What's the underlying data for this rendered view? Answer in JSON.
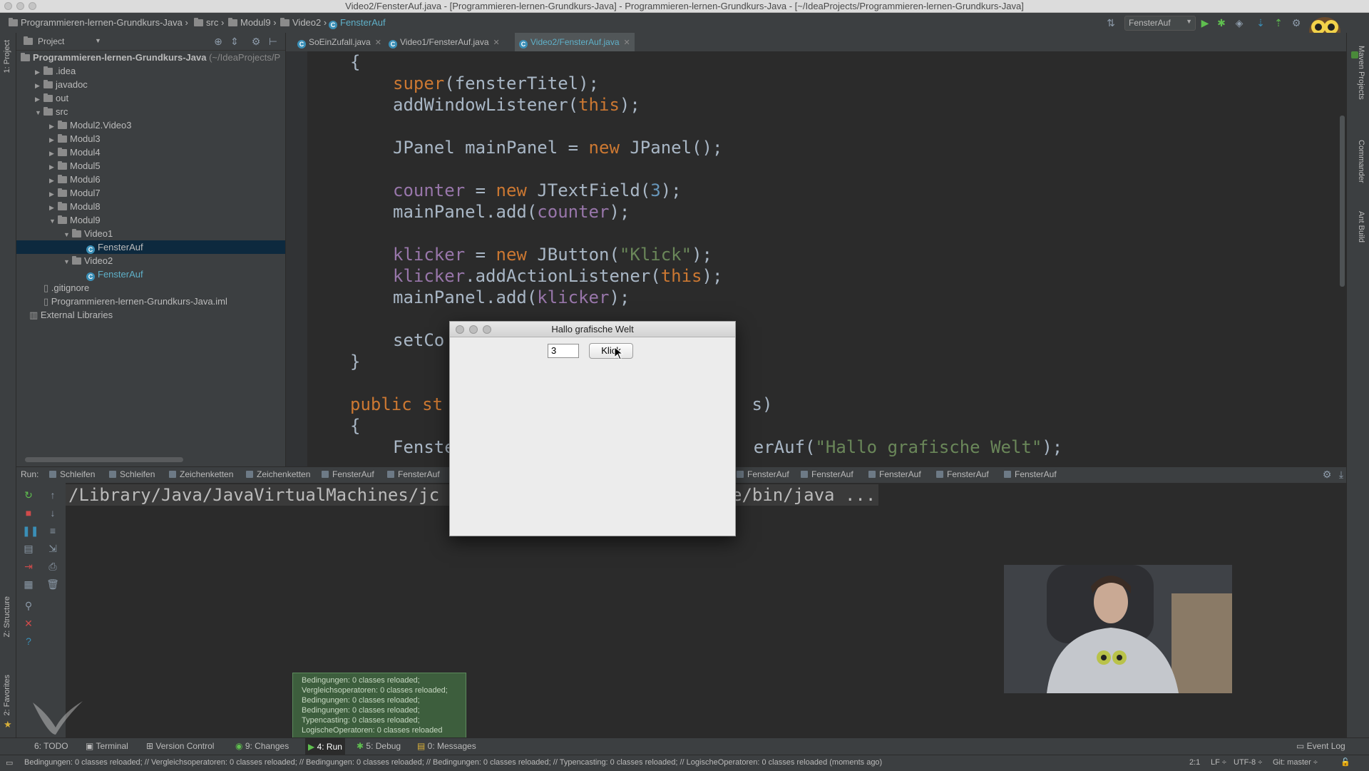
{
  "window": {
    "title": "Video2/FensterAuf.java - [Programmieren-lernen-Grundkurs-Java] - Programmieren-lernen-Grundkurs-Java - [~/IdeaProjects/Programmieren-lernen-Grundkurs-Java]"
  },
  "breadcrumb": [
    "Programmieren-lernen-Grundkurs-Java",
    "src",
    "Modul9",
    "Video2",
    "FensterAuf"
  ],
  "run_config": "FensterAuf",
  "project_panel": {
    "header": "Project",
    "root_name": "Programmieren-lernen-Grundkurs-Java",
    "root_path": "(~/IdeaProjects/P",
    "items": [
      {
        "label": ".idea",
        "indent": 1,
        "arrow": "▶"
      },
      {
        "label": "javadoc",
        "indent": 1,
        "arrow": "▶"
      },
      {
        "label": "out",
        "indent": 1,
        "arrow": "▶"
      },
      {
        "label": "src",
        "indent": 1,
        "arrow": "▼"
      },
      {
        "label": "Modul2.Video3",
        "indent": 2,
        "arrow": "▶"
      },
      {
        "label": "Modul3",
        "indent": 2,
        "arrow": "▶"
      },
      {
        "label": "Modul4",
        "indent": 2,
        "arrow": "▶"
      },
      {
        "label": "Modul5",
        "indent": 2,
        "arrow": "▶"
      },
      {
        "label": "Modul6",
        "indent": 2,
        "arrow": "▶"
      },
      {
        "label": "Modul7",
        "indent": 2,
        "arrow": "▶"
      },
      {
        "label": "Modul8",
        "indent": 2,
        "arrow": "▶"
      },
      {
        "label": "Modul9",
        "indent": 2,
        "arrow": "▼"
      },
      {
        "label": "Video1",
        "indent": 3,
        "arrow": "▼"
      },
      {
        "label": "FensterAuf",
        "indent": 4,
        "arrow": ""
      },
      {
        "label": "Video2",
        "indent": 3,
        "arrow": "▼"
      },
      {
        "label": "FensterAuf",
        "indent": 4,
        "arrow": ""
      },
      {
        "label": ".gitignore",
        "indent": 1,
        "arrow": ""
      },
      {
        "label": "Programmieren-lernen-Grundkurs-Java.iml",
        "indent": 1,
        "arrow": ""
      },
      {
        "label": "External Libraries",
        "indent": 0,
        "arrow": ""
      }
    ]
  },
  "editor_tabs": [
    {
      "label": "SoEinZufall.java",
      "active": false
    },
    {
      "label": "Video1/FensterAuf.java",
      "active": false
    },
    {
      "label": "Video2/FensterAuf.java",
      "active": true
    }
  ],
  "code_lines": [
    {
      "indent": 1,
      "tokens": [
        {
          "t": "{",
          "c": ""
        }
      ]
    },
    {
      "indent": 2,
      "tokens": [
        {
          "t": "super",
          "c": "kw"
        },
        {
          "t": "(fensterTitel);",
          "c": ""
        }
      ]
    },
    {
      "indent": 2,
      "tokens": [
        {
          "t": "addWindowListener(",
          "c": ""
        },
        {
          "t": "this",
          "c": "kw"
        },
        {
          "t": ");",
          "c": ""
        }
      ]
    },
    {
      "indent": 0,
      "tokens": []
    },
    {
      "indent": 2,
      "tokens": [
        {
          "t": "JPanel mainPanel = ",
          "c": ""
        },
        {
          "t": "new",
          "c": "kw"
        },
        {
          "t": " JPanel();",
          "c": ""
        }
      ]
    },
    {
      "indent": 0,
      "tokens": []
    },
    {
      "indent": 2,
      "tokens": [
        {
          "t": "counter",
          "c": "fld"
        },
        {
          "t": " = ",
          "c": ""
        },
        {
          "t": "new",
          "c": "kw"
        },
        {
          "t": " JTextField(",
          "c": ""
        },
        {
          "t": "3",
          "c": "num"
        },
        {
          "t": ");",
          "c": ""
        }
      ]
    },
    {
      "indent": 2,
      "tokens": [
        {
          "t": "mainPanel.add(",
          "c": ""
        },
        {
          "t": "counter",
          "c": "fld"
        },
        {
          "t": ");",
          "c": ""
        }
      ]
    },
    {
      "indent": 0,
      "tokens": []
    },
    {
      "indent": 2,
      "tokens": [
        {
          "t": "klicker",
          "c": "fld"
        },
        {
          "t": " = ",
          "c": ""
        },
        {
          "t": "new",
          "c": "kw"
        },
        {
          "t": " JButton(",
          "c": ""
        },
        {
          "t": "\"Klick\"",
          "c": "str"
        },
        {
          "t": ");",
          "c": ""
        }
      ]
    },
    {
      "indent": 2,
      "tokens": [
        {
          "t": "klicker",
          "c": "fld"
        },
        {
          "t": ".addActionListener(",
          "c": ""
        },
        {
          "t": "this",
          "c": "kw"
        },
        {
          "t": ");",
          "c": ""
        }
      ]
    },
    {
      "indent": 2,
      "tokens": [
        {
          "t": "mainPanel.add(",
          "c": ""
        },
        {
          "t": "klicker",
          "c": "fld"
        },
        {
          "t": ");",
          "c": ""
        }
      ]
    },
    {
      "indent": 0,
      "tokens": []
    },
    {
      "indent": 2,
      "tokens": [
        {
          "t": "setCo",
          "c": ""
        }
      ]
    },
    {
      "indent": 1,
      "tokens": [
        {
          "t": "}",
          "c": ""
        }
      ]
    },
    {
      "indent": 0,
      "tokens": []
    },
    {
      "indent": 1,
      "tokens": [
        {
          "t": "public",
          "c": "kw"
        },
        {
          "t": " ",
          "c": ""
        },
        {
          "t": "st",
          "c": "kw"
        },
        {
          "t": "                              s)",
          "c": ""
        }
      ]
    },
    {
      "indent": 1,
      "tokens": [
        {
          "t": "{",
          "c": ""
        }
      ]
    },
    {
      "indent": 2,
      "tokens": [
        {
          "t": "Fenste",
          "c": ""
        },
        {
          "t": "                             erAuf(",
          "c": ""
        },
        {
          "t": "\"Hallo grafische Welt\"",
          "c": "str"
        },
        {
          "t": ");",
          "c": ""
        }
      ]
    }
  ],
  "run_panel": {
    "label": "Run:",
    "tabs": [
      "Schleifen",
      "Schleifen",
      "Zeichenketten",
      "Zeichenketten",
      "FensterAuf",
      "FensterAuf",
      "FensterAuf",
      "FensterAuf",
      "FensterAuf",
      "FensterAuf",
      "FensterAuf"
    ],
    "console_line_start": "/Library/Java/JavaVirtualMachines/jc",
    "console_line_end": "e/bin/java ..."
  },
  "swing_window": {
    "title": "Hallo grafische Welt",
    "field_value": "3",
    "button_label": "Klick"
  },
  "notification": {
    "lines": [
      "Bedingungen: 0 classes reloaded;",
      "Vergleichsoperatoren: 0 classes reloaded;",
      "Bedingungen: 0 classes reloaded;",
      "Bedingungen: 0 classes reloaded;",
      "Typencasting: 0 classes reloaded;",
      "LogischeOperatoren: 0 classes reloaded"
    ]
  },
  "bottom_tools": [
    "6: TODO",
    "Terminal",
    "Version Control",
    "9: Changes",
    "4: Run",
    "5: Debug",
    "0: Messages"
  ],
  "event_log": "Event Log",
  "status": {
    "message": "Bedingungen: 0 classes reloaded; // Vergleichsoperatoren: 0 classes reloaded; // Bedingungen: 0 classes reloaded; // Bedingungen: 0 classes reloaded; // Typencasting: 0 classes reloaded; // LogischeOperatoren: 0 classes reloaded (moments ago)",
    "position": "2:1",
    "line_sep": "LF ÷",
    "encoding": "UTF-8 ÷",
    "vcs": "Git: master ÷"
  },
  "side_labels": {
    "left_top": "1: Project",
    "left_structure": "Z: Structure",
    "left_favorites": "2: Favorites",
    "right_maven": "Maven Projects",
    "right_commander": "Commander",
    "right_ant": "Ant Build"
  },
  "colors": {
    "editor_bg": "#2b2b2b",
    "panel_bg": "#3c3f41",
    "keyword": "#cc7832",
    "field": "#9876aa",
    "string": "#6a8759",
    "selection": "#214283"
  }
}
